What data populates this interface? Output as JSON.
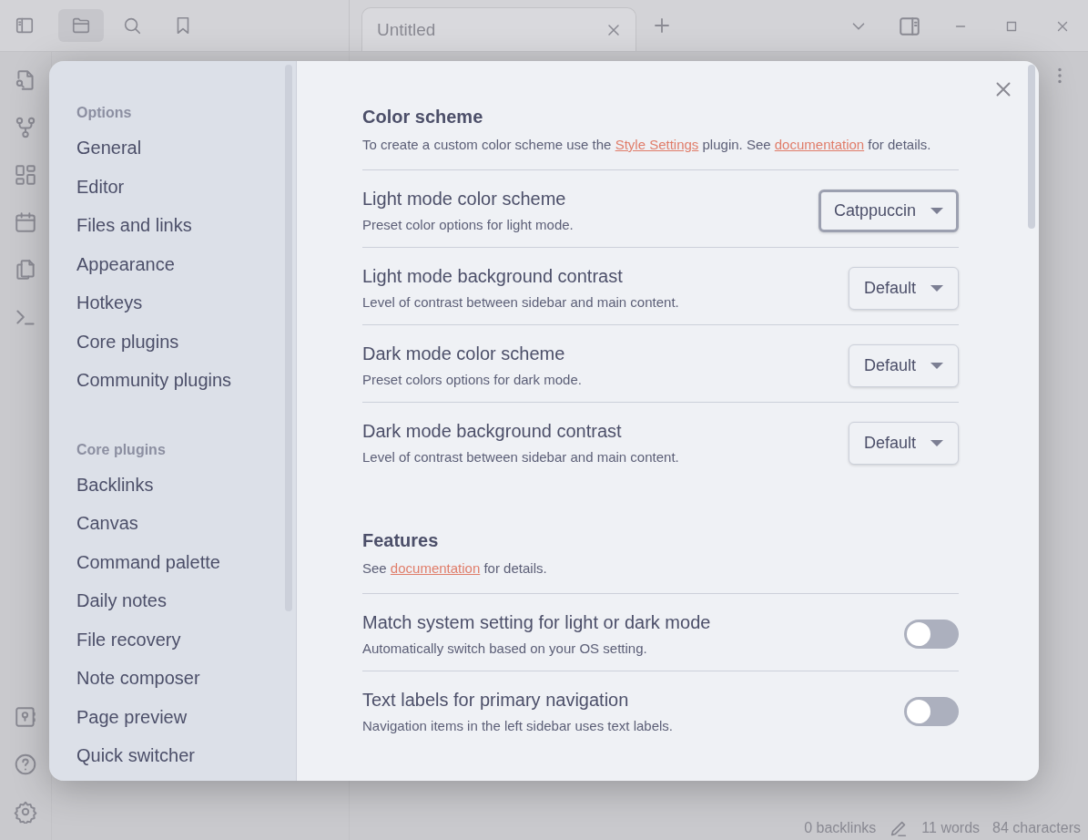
{
  "left_panel_tabs": [
    {
      "kind": "files",
      "selected": true
    },
    {
      "kind": "search",
      "selected": false
    },
    {
      "kind": "bookmarks",
      "selected": false
    }
  ],
  "tab": {
    "title": "Untitled"
  },
  "settings_nav": [
    {
      "heading": "Options",
      "items": [
        "General",
        "Editor",
        "Files and links",
        "Appearance",
        "Hotkeys",
        "Core plugins",
        "Community plugins"
      ]
    },
    {
      "heading": "Core plugins",
      "items": [
        "Backlinks",
        "Canvas",
        "Command palette",
        "Daily notes",
        "File recovery",
        "Note composer",
        "Page preview",
        "Quick switcher"
      ]
    }
  ],
  "sections": [
    {
      "title": "Color scheme",
      "description": [
        {
          "kind": "text",
          "text": "To create a custom color scheme use the "
        },
        {
          "kind": "link",
          "text": "Style Settings"
        },
        {
          "kind": "text",
          "text": " plugin. See "
        },
        {
          "kind": "link",
          "text": "documentation"
        },
        {
          "kind": "text",
          "text": " for details."
        }
      ],
      "settings": [
        {
          "kind": "dropdown",
          "name": "Light mode color scheme",
          "description": "Preset color options for light mode.",
          "value": "Catppuccin",
          "focused": true
        },
        {
          "kind": "dropdown",
          "name": "Light mode background contrast",
          "description": "Level of contrast between sidebar and main content.",
          "value": "Default",
          "focused": false
        },
        {
          "kind": "dropdown",
          "name": "Dark mode color scheme",
          "description": "Preset colors options for dark mode.",
          "value": "Default",
          "focused": false
        },
        {
          "kind": "dropdown",
          "name": "Dark mode background contrast",
          "description": "Level of contrast between sidebar and main content.",
          "value": "Default",
          "focused": false
        }
      ]
    },
    {
      "title": "Features",
      "description": [
        {
          "kind": "text",
          "text": "See "
        },
        {
          "kind": "link",
          "text": "documentation"
        },
        {
          "kind": "text",
          "text": " for details."
        }
      ],
      "settings": [
        {
          "kind": "toggle",
          "name": "Match system setting for light or dark mode",
          "description": "Automatically switch based on your OS setting.",
          "on": false
        },
        {
          "kind": "toggle",
          "name": "Text labels for primary navigation",
          "description": "Navigation items in the left sidebar uses text labels.",
          "on": false
        }
      ]
    }
  ],
  "status_bar": {
    "backlinks": "0 backlinks",
    "words": "11 words",
    "characters": "84 characters"
  }
}
